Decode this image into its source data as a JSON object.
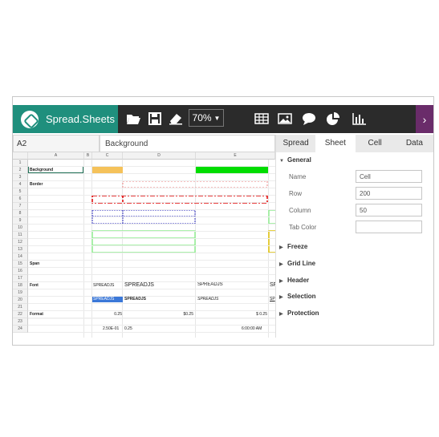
{
  "app": {
    "title": "Spread.Sheets"
  },
  "toolbar": {
    "zoom": "70%",
    "icons": [
      "folder-open-icon",
      "save-icon",
      "eraser-icon",
      "table-icon",
      "image-icon",
      "comment-icon",
      "pie-chart-icon",
      "bar-chart-icon"
    ],
    "more": "›"
  },
  "formula_bar": {
    "name_box": "A2",
    "value": "Background"
  },
  "grid": {
    "columns": [
      "A",
      "B",
      "C",
      "D",
      "E"
    ],
    "rows": [
      "1",
      "2",
      "3",
      "4",
      "5",
      "6",
      "7",
      "8",
      "9",
      "10",
      "11",
      "12",
      "13",
      "14",
      "15",
      "16",
      "17",
      "18",
      "19",
      "20",
      "21",
      "22",
      "23",
      "24"
    ],
    "cells": {
      "a2": "Background",
      "a4": "Border",
      "a15": "Span",
      "a18": "Font",
      "a22": "Format",
      "c18": "SPREADJS",
      "d18": "SPREADJS",
      "e18": "SPREADJS",
      "f18": "SF",
      "c20": "SPREADJS",
      "d20": "SPREADJS",
      "e20": "SPREADJS",
      "f20": "SP",
      "c22": "0.25",
      "d22": "$0.25",
      "e22": "$ 0.25",
      "c24a": "2.50E-01",
      "c24b": "0.25",
      "e24": "6:00:00 AM"
    },
    "colors": {
      "orange": "#f5c25a",
      "green": "#00dd00",
      "red": "#e00000",
      "blue": "#3030c0",
      "light_green": "#90ee90",
      "yellow": "#e0c000"
    }
  },
  "panel": {
    "tabs": [
      "Spread",
      "Sheet",
      "Cell",
      "Data"
    ],
    "active_tab": "Sheet",
    "sections": {
      "general": "General",
      "freeze": "Freeze",
      "grid_line": "Grid Line",
      "header": "Header",
      "selection": "Selection",
      "protection": "Protection"
    },
    "fields": {
      "name_label": "Name",
      "name_value": "Cell",
      "row_label": "Row",
      "row_value": "200",
      "column_label": "Column",
      "column_value": "50",
      "tab_color_label": "Tab Color",
      "tab_color_value": ""
    }
  }
}
